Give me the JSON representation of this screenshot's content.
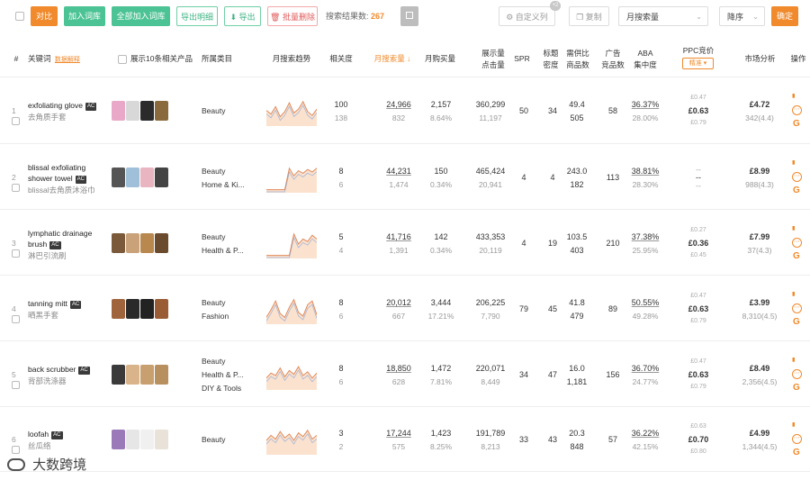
{
  "toolbar": {
    "compare": "对比",
    "add_to_list": "加入词库",
    "add_all_to_list": "全部加入词库",
    "export_detail": "导出明细",
    "export": "导出",
    "batch_delete": "批量删除",
    "result_label": "搜索结果数:",
    "result_count": "267",
    "custom_columns": "自定义列",
    "custom_badge": "+2",
    "copy": "复制",
    "sort_field": "月搜索量",
    "sort_order": "降序",
    "confirm": "确定"
  },
  "headers": {
    "index": "#",
    "keyword": "关键词",
    "keyword_tag": "数据解释",
    "show_products": "展示10条相关产品",
    "category": "所属类目",
    "trend": "月搜索趋势",
    "relevance": "相关度",
    "monthly_search": "月搜索量 ↓",
    "monthly_purchase": "月购买量",
    "impressions": "展示量",
    "clicks": "点击量",
    "spr": "SPR",
    "title_density1": "标题",
    "title_density2": "密度",
    "supply_ratio1": "需供比",
    "supply_ratio2": "商品数",
    "ad_products1": "广告",
    "ad_products2": "竞品数",
    "aba1": "ABA",
    "aba2": "集中度",
    "ppc": "PPC竞价",
    "ppc_mode": "精准 ▾",
    "market": "市场分析",
    "ops": "操作"
  },
  "rows": [
    {
      "idx": "1",
      "keyword": "exfoliating glove",
      "ac": "AC",
      "cn": "去角质手套",
      "categories": [
        "Beauty"
      ],
      "relevance": "100",
      "relevance_sub": "138",
      "search": "24,966",
      "search_sub": "832",
      "purchase": "2,157",
      "purchase_sub": "8.64%",
      "impressions": "360,299",
      "clicks": "11,197",
      "spr": "50",
      "density": "34",
      "supply": "49.4",
      "products": "505",
      "ads": "58",
      "aba": "36.37%",
      "aba_sub": "28.00%",
      "ppc_low": "£0.47",
      "ppc_mid": "£0.63",
      "ppc_high": "£0.79",
      "price": "£4.72",
      "rating": "342(4.4)",
      "thumb_colors": [
        "#e9a8c8",
        "#d8d8d8",
        "#2b2b2b",
        "#8a6a3c"
      ],
      "trend": [
        0.55,
        0.4,
        0.7,
        0.3,
        0.5,
        0.85,
        0.45,
        0.6,
        0.9,
        0.5,
        0.35,
        0.6
      ]
    },
    {
      "idx": "2",
      "keyword": "blissal exfoliating",
      "keyword2": "shower towel",
      "ac": "AC",
      "cn": "blissal去角质沐浴巾",
      "categories": [
        "Beauty",
        "Home & Ki..."
      ],
      "relevance": "8",
      "relevance_sub": "6",
      "search": "44,231",
      "search_sub": "1,474",
      "purchase": "150",
      "purchase_sub": "0.34%",
      "impressions": "465,424",
      "clicks": "20,941",
      "spr": "4",
      "density": "4",
      "supply": "243.0",
      "products": "182",
      "ads": "113",
      "aba": "38.81%",
      "aba_sub": "28.30%",
      "ppc_low": "",
      "ppc_mid": "--",
      "ppc_high": "",
      "ppc_top": "--",
      "ppc_bottom": "--",
      "price": "£8.99",
      "rating": "988(4.3)",
      "thumb_colors": [
        "#555555",
        "#9fc0d8",
        "#e8b5c0",
        "#444444"
      ],
      "trend": [
        0.05,
        0.05,
        0.05,
        0.05,
        0.05,
        0.9,
        0.6,
        0.8,
        0.7,
        0.85,
        0.75,
        0.9
      ]
    },
    {
      "idx": "3",
      "keyword": "lymphatic drainage",
      "keyword2": "brush",
      "ac": "AC",
      "cn": "淋巴引流刷",
      "categories": [
        "Beauty",
        "Health & P..."
      ],
      "relevance": "5",
      "relevance_sub": "4",
      "search": "41,716",
      "search_sub": "1,391",
      "purchase": "142",
      "purchase_sub": "0.34%",
      "impressions": "433,353",
      "clicks": "20,119",
      "spr": "4",
      "density": "19",
      "supply": "103.5",
      "products": "403",
      "ads": "210",
      "aba": "37.38%",
      "aba_sub": "25.95%",
      "ppc_low": "£0.27",
      "ppc_mid": "£0.36",
      "ppc_high": "£0.45",
      "price": "£7.99",
      "rating": "37(4.3)",
      "thumb_colors": [
        "#7a5a3a",
        "#c9a27a",
        "#b8884e",
        "#6b4b2e"
      ],
      "trend": [
        0.05,
        0.05,
        0.05,
        0.05,
        0.05,
        0.05,
        0.9,
        0.5,
        0.7,
        0.6,
        0.85,
        0.7
      ]
    },
    {
      "idx": "4",
      "keyword": "tanning mitt",
      "ac": "AC",
      "cn": "晒黑手套",
      "categories": [
        "Beauty",
        "Fashion"
      ],
      "relevance": "8",
      "relevance_sub": "6",
      "search": "20,012",
      "search_sub": "667",
      "purchase": "3,444",
      "purchase_sub": "17.21%",
      "impressions": "206,225",
      "clicks": "7,790",
      "spr": "79",
      "density": "45",
      "supply": "41.8",
      "products": "479",
      "ads": "89",
      "aba": "50.55%",
      "aba_sub": "49.28%",
      "ppc_low": "£0.47",
      "ppc_mid": "£0.63",
      "ppc_high": "£0.79",
      "price": "£3.99",
      "rating": "8,310(4.5)",
      "thumb_colors": [
        "#a0643c",
        "#2a2a2a",
        "#222222",
        "#9a5c34"
      ],
      "trend": [
        0.2,
        0.5,
        0.85,
        0.35,
        0.2,
        0.6,
        0.9,
        0.4,
        0.25,
        0.7,
        0.85,
        0.3
      ]
    },
    {
      "idx": "5",
      "keyword": "back scrubber",
      "ac": "AC",
      "cn": "背部洗涤器",
      "categories": [
        "Beauty",
        "Health & P...",
        "DIY & Tools"
      ],
      "relevance": "8",
      "relevance_sub": "6",
      "search": "18,850",
      "search_sub": "628",
      "purchase": "1,472",
      "purchase_sub": "7.81%",
      "impressions": "220,071",
      "clicks": "8,449",
      "spr": "34",
      "density": "47",
      "supply": "16.0",
      "products": "1,181",
      "ads": "156",
      "aba": "36.70%",
      "aba_sub": "24.77%",
      "ppc_low": "£0.47",
      "ppc_mid": "£0.63",
      "ppc_high": "£0.79",
      "price": "£8.49",
      "rating": "2,356(4.5)",
      "thumb_colors": [
        "#3a3a3a",
        "#d9b48a",
        "#c8a070",
        "#b89060"
      ],
      "trend": [
        0.4,
        0.6,
        0.5,
        0.8,
        0.45,
        0.7,
        0.55,
        0.85,
        0.5,
        0.65,
        0.4,
        0.6
      ]
    },
    {
      "idx": "6",
      "keyword": "loofah",
      "ac": "AC",
      "cn": "丝瓜络",
      "categories": [
        "Beauty"
      ],
      "relevance": "3",
      "relevance_sub": "2",
      "search": "17,244",
      "search_sub": "575",
      "purchase": "1,423",
      "purchase_sub": "8.25%",
      "impressions": "191,789",
      "clicks": "8,213",
      "spr": "33",
      "density": "43",
      "supply": "20.3",
      "products": "848",
      "ads": "57",
      "aba": "36.22%",
      "aba_sub": "42.15%",
      "ppc_low": "£0.63",
      "ppc_mid": "£0.70",
      "ppc_high": "£0.80",
      "price": "£4.99",
      "rating": "1,344(4.5)",
      "thumb_colors": [
        "#9a7ab8",
        "#e6e6e6",
        "#f0f0f0",
        "#e9e2d8"
      ],
      "trend": [
        0.5,
        0.7,
        0.55,
        0.85,
        0.6,
        0.75,
        0.5,
        0.8,
        0.65,
        0.9,
        0.55,
        0.7
      ]
    }
  ],
  "watermark": "大数跨境",
  "colors": {
    "orange": "#f08a2c",
    "green": "#4cc394",
    "trend_line": "#e08a5a",
    "trend_fill": "#fbe2cf",
    "trend_blue": "#5b8fd8"
  }
}
